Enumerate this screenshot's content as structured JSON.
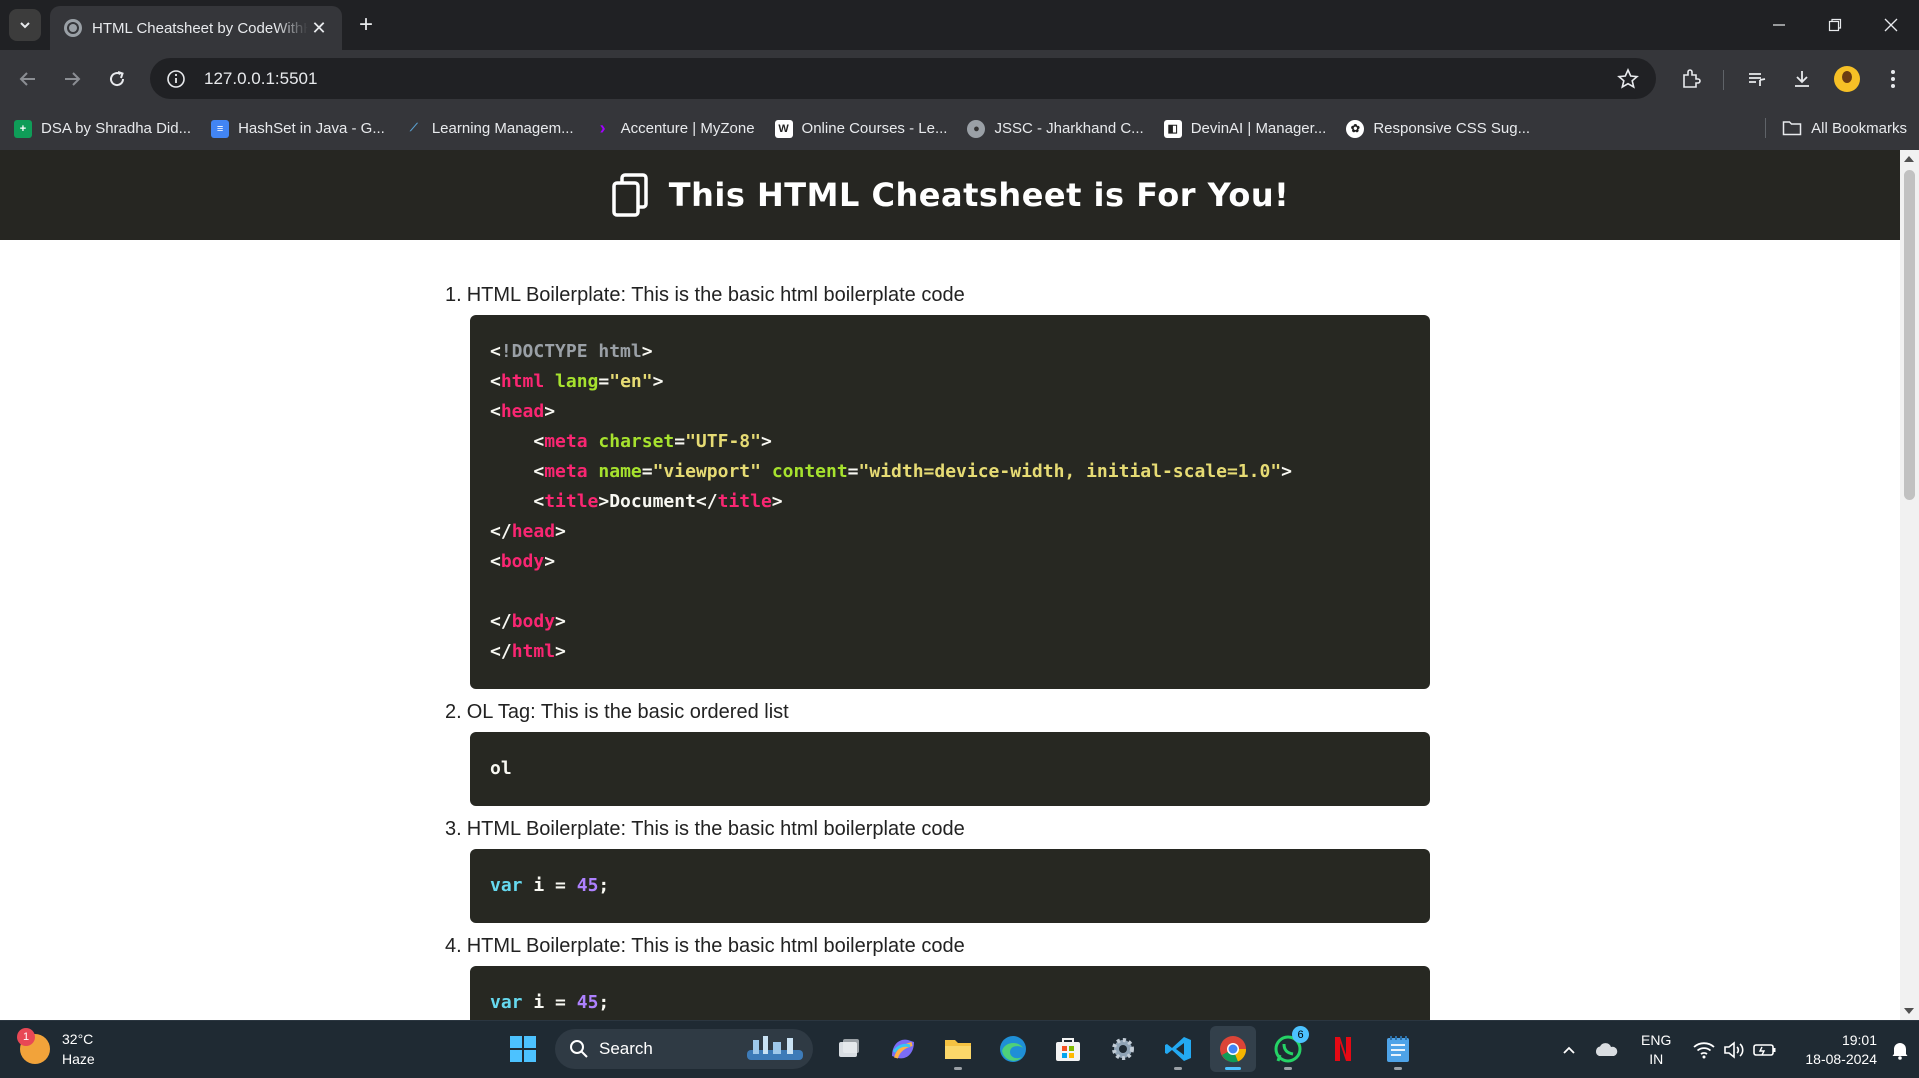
{
  "browser": {
    "tab_title": "HTML Cheatsheet by CodeWithHarry",
    "url": "127.0.0.1:5501",
    "bookmarks": [
      {
        "label": "DSA by Shradha Did...",
        "color": "#0f9d58"
      },
      {
        "label": "HashSet in Java - G...",
        "color": "#4285f4"
      },
      {
        "label": "Learning Managem...",
        "color": "#5aa0d0"
      },
      {
        "label": "Accenture | MyZone",
        "color": "#a100ff"
      },
      {
        "label": "Online Courses - Le...",
        "color": "#ffffff"
      },
      {
        "label": "JSSC - Jharkhand C...",
        "color": "#9aa0a6"
      },
      {
        "label": "DevinAI | Manager...",
        "color": "#ffffff"
      },
      {
        "label": "Responsive CSS Sug...",
        "color": "#ffffff"
      }
    ],
    "all_bookmarks_label": "All Bookmarks"
  },
  "page": {
    "heading": "This HTML Cheatsheet is For You!",
    "items": [
      {
        "number": "1.",
        "label": "HTML Boilerplate: This is the basic html boilerplate code"
      },
      {
        "number": "2.",
        "label": "OL Tag: This is the basic ordered list"
      },
      {
        "number": "3.",
        "label": "HTML Boilerplate: This is the basic html boilerplate code"
      },
      {
        "number": "4.",
        "label": "HTML Boilerplate: This is the basic html boilerplate code"
      }
    ],
    "code1": {
      "doctype": "!DOCTYPE html",
      "html_tag": "html",
      "lang_attr": "lang",
      "lang_val": "\"en\"",
      "head": "head",
      "meta": "meta",
      "charset_attr": "charset",
      "charset_val": "\"UTF-8\"",
      "name_attr": "name",
      "name_val": "\"viewport\"",
      "content_attr": "content",
      "content_val": "\"width=device-width, initial-scale=1.0\"",
      "title": "title",
      "title_text": "Document",
      "body": "body"
    },
    "code2": "ol",
    "code3": {
      "kw": "var",
      "ident": "i",
      "op": "=",
      "num": "45",
      "end": ";"
    },
    "code4": {
      "kw": "var",
      "ident": "i",
      "op": "=",
      "num": "45",
      "end": ";"
    }
  },
  "taskbar": {
    "weather_badge": "1",
    "temperature": "32°C",
    "condition": "Haze",
    "search_label": "Search",
    "whatsapp_badge": "6",
    "lang_line1": "ENG",
    "lang_line2": "IN",
    "time": "19:01",
    "date": "18-08-2024"
  }
}
